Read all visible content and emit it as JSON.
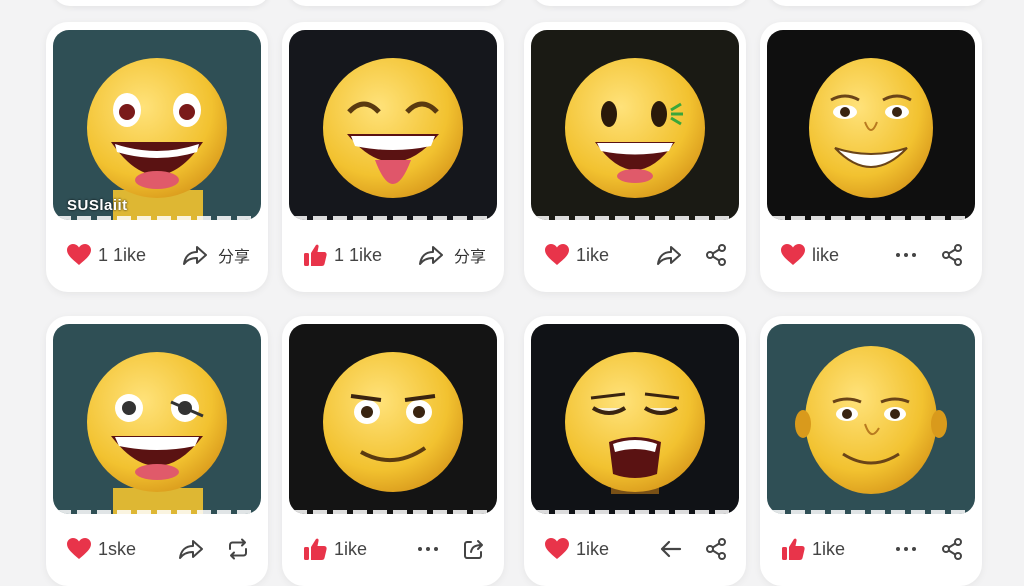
{
  "colors": {
    "like_red": "#e8344a",
    "icon_gray": "#444444",
    "card_bg": "#ffffff",
    "page_bg": "#f3f3f4"
  },
  "cards": [
    {
      "bg": "#2f4f55",
      "face": "laugh-big-eyes",
      "caption": "SUSlaiit",
      "like_icon": "heart-icon",
      "like_label": "1 1ike",
      "share_icon": "share-arrow-icon",
      "share_label": "分享",
      "more_icon": null
    },
    {
      "bg": "#15171c",
      "face": "laugh-tongue",
      "caption": "",
      "like_icon": "thumbs-up-icon",
      "like_label": "1 1ike",
      "share_icon": "share-arrow-icon",
      "share_label": "分享",
      "more_icon": null
    },
    {
      "bg": "#1a1a14",
      "face": "smile-wink",
      "caption": "",
      "like_icon": "heart-icon",
      "like_label": "1ike",
      "share_icon": "share-arrow-icon",
      "share_label": "",
      "more_icon": "share-nodes-icon"
    },
    {
      "bg": "#0f0f0f",
      "face": "grin-man",
      "caption": "",
      "like_icon": "heart-icon",
      "like_label": "like",
      "share_icon": "more-dots-icon",
      "share_label": "",
      "more_icon": "share-nodes-icon"
    },
    {
      "bg": "#2f4f55",
      "face": "laugh-wink",
      "caption": "",
      "like_icon": "heart-icon",
      "like_label": "1ske",
      "share_icon": "share-arrow-icon",
      "share_label": "",
      "more_icon": "repost-icon"
    },
    {
      "bg": "#141414",
      "face": "smirk",
      "caption": "",
      "like_icon": "thumbs-up-icon",
      "like_label": "1ike",
      "share_icon": "more-dots-icon",
      "share_label": "",
      "more_icon": "export-icon"
    },
    {
      "bg": "#101216",
      "face": "tired",
      "caption": "",
      "like_icon": "heart-icon",
      "like_label": "1ike",
      "share_icon": "back-arrow-icon",
      "share_label": "",
      "more_icon": "share-nodes-icon"
    },
    {
      "bg": "#2f4f55",
      "face": "bald-man",
      "caption": "",
      "like_icon": "thumbs-up-icon",
      "like_label": "1ike",
      "share_icon": "more-dots-icon",
      "share_label": "",
      "more_icon": "share-nodes-icon"
    }
  ]
}
